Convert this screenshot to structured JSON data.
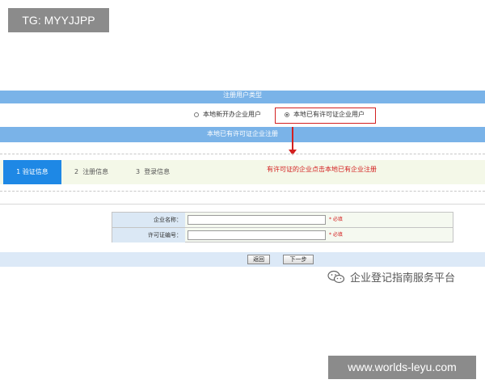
{
  "watermark_top": "TG: MYYJJPP",
  "watermark_bottom": "www.worlds-leyu.com",
  "section_title": "注册用户类型",
  "radio_options": [
    {
      "label": "本地新开办企业用户",
      "selected": false
    },
    {
      "label": "本地已有许可证企业用户",
      "selected": true
    }
  ],
  "sub_title": "本地已有许可证企业注册",
  "steps": [
    {
      "num": "1",
      "label": "验证信息",
      "active": true
    },
    {
      "num": "2",
      "label": "注册信息",
      "active": false
    },
    {
      "num": "3",
      "label": "登录信息",
      "active": false
    }
  ],
  "annotation": "有许可证的企业点击本地已有企业注册",
  "form": {
    "company_name_label": "企业名称：",
    "license_no_label": "许可证编号：",
    "required_mark": "* 必填"
  },
  "buttons": {
    "back": "返回",
    "next": "下一步"
  },
  "brand_text": "企业登记指南服务平台",
  "colors": {
    "header_bar": "#7ab3e8",
    "active_step": "#1e88e5",
    "annotation_red": "#d32020"
  }
}
